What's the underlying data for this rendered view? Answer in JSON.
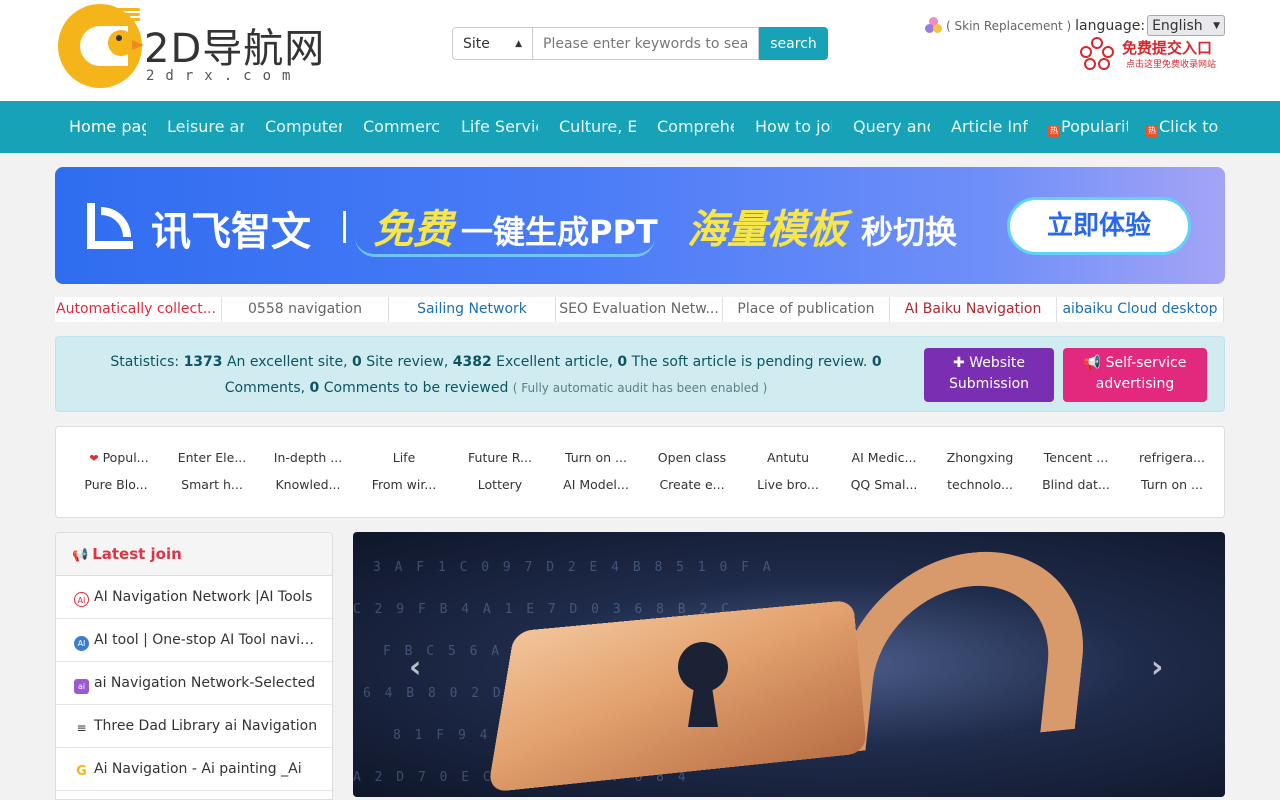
{
  "header": {
    "logo_title": "2D导航网",
    "logo_sub": "2drx.com",
    "search": {
      "select_value": "Site",
      "placeholder": "Please enter keywords to search",
      "button_label": "search"
    },
    "skin_label": "( Skin Replacement )",
    "language_label": "language:",
    "language_value": "English",
    "free_submit_title": "免费提交入口",
    "free_submit_sub": "点击这里免费收录网站"
  },
  "nav": {
    "items": [
      {
        "label": "Home page"
      },
      {
        "label": "Leisure and entertainment"
      },
      {
        "label": "Computer network"
      },
      {
        "label": "Commerce"
      },
      {
        "label": "Life Services"
      },
      {
        "label": "Culture, Education"
      },
      {
        "label": "Comprehensive"
      },
      {
        "label": "How to join"
      },
      {
        "label": "Query and"
      },
      {
        "label": "Article Information"
      },
      {
        "label": "Popularity"
      },
      {
        "label": "Click to"
      }
    ]
  },
  "banner": {
    "brand": "讯飞智文",
    "free": "免费",
    "generate": "一键生成PPT",
    "mass": "海量模板",
    "switch": "秒切换",
    "button": "立即体验"
  },
  "links": [
    {
      "label": "Automatically collect...",
      "color": "#e3293c"
    },
    {
      "label": "0558 navigation",
      "color": "#666666"
    },
    {
      "label": "Sailing Network",
      "color": "#1a6fb5"
    },
    {
      "label": "SEO Evaluation Netw...",
      "color": "#666666"
    },
    {
      "label": "Place of publication",
      "color": "#666666"
    },
    {
      "label": "AI Baiku Navigation",
      "color": "#b0282e"
    },
    {
      "label": "aibaiku Cloud desktop",
      "color": "#1a6fb5"
    }
  ],
  "stats": {
    "label": "Statistics:",
    "sites": "1373",
    "sites_label": "An excellent site,",
    "review": "0",
    "review_label": "Site review,",
    "articles": "4382",
    "articles_label": "Excellent article,",
    "pending": "0",
    "pending_label": "The soft article is pending review.",
    "comments": "0",
    "comments_label": "Comments,",
    "comments_review": "0",
    "comments_review_label": "Comments to be reviewed",
    "note": "( Fully automatic audit has been enabled )",
    "submit_button": "Website Submission",
    "ads_button": "Self-service advertising"
  },
  "hotgrid": {
    "row1": [
      "Popul...",
      "Enter Ele...",
      "In-depth ...",
      "Life",
      "Future R...",
      "Turn on ...",
      "Open class",
      "Antutu",
      "AI Medic...",
      "Zhongxing",
      "Tencent ...",
      "refrigera..."
    ],
    "row2": [
      "Pure Blo...",
      "Smart h...",
      "Knowled...",
      "From wir...",
      "Lottery",
      "AI Model...",
      "Create e...",
      "Live bro...",
      "QQ Smal...",
      "technolo...",
      "Blind dat...",
      "Turn on ..."
    ]
  },
  "latest": {
    "title": "Latest join",
    "items": [
      {
        "label": "AI Navigation Network |AI Tools",
        "icon_color": "#e3293c",
        "icon": "AI"
      },
      {
        "label": "AI tool | One-stop AI Tool navigation",
        "icon_color": "#3a7bd5",
        "icon": "AI"
      },
      {
        "label": "ai Navigation Network-Selected",
        "icon_color": "#9b59d6",
        "icon": "ai"
      },
      {
        "label": "Three Dad Library ai Navigation",
        "icon_color": "#333333",
        "icon": "≡"
      },
      {
        "label": "Ai Navigation - Ai painting _Ai",
        "icon_color": "#f5b51a",
        "icon": "G"
      }
    ]
  },
  "carousel": {
    "prev_icon": "chevron-left-icon",
    "next_icon": "chevron-right-icon"
  }
}
